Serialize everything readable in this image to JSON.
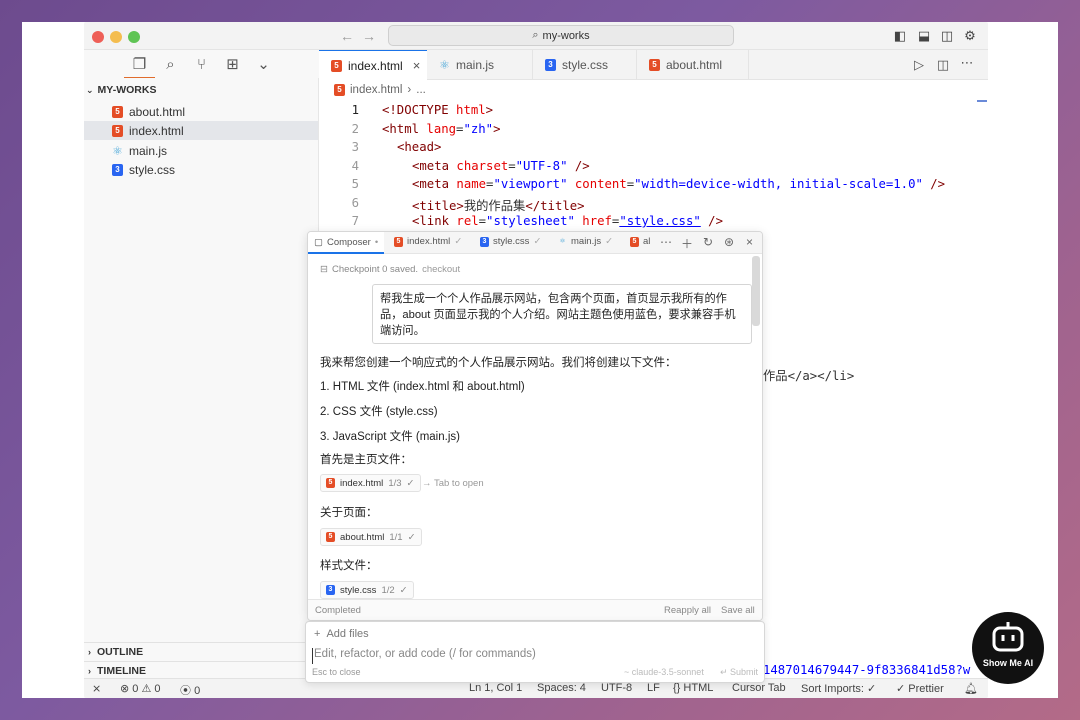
{
  "window": {
    "search_title": "my-works"
  },
  "sidebar": {
    "folder": "MY-WORKS",
    "files": [
      {
        "name": "about.html",
        "type": "html"
      },
      {
        "name": "index.html",
        "type": "html"
      },
      {
        "name": "main.js",
        "type": "js"
      },
      {
        "name": "style.css",
        "type": "css"
      }
    ],
    "outline": "OUTLINE",
    "timeline": "TIMELINE"
  },
  "tabs": [
    "index.html",
    "main.js",
    "style.css",
    "about.html"
  ],
  "breadcrumb": {
    "file": "index.html",
    "more": "..."
  },
  "code": {
    "line_numbers": [
      "1",
      "2",
      "3",
      "4",
      "5",
      "6",
      "7"
    ],
    "line1": [
      "<!DOCTYPE ",
      "html",
      ">"
    ],
    "line2": [
      "<html ",
      "lang",
      "=",
      "\"zh\"",
      ">"
    ],
    "line3": [
      "<head>"
    ],
    "line4": [
      "<meta ",
      "charset",
      "=",
      "\"UTF-8\"",
      " />"
    ],
    "line5": [
      "<meta ",
      "name",
      "=",
      "\"viewport\"",
      " ",
      "content",
      "=",
      "\"width=device-width, initial-scale=1.0\"",
      " />"
    ],
    "line6": [
      "<title>",
      "我的作品集",
      "</title>"
    ],
    "line7": [
      "<link ",
      "rel",
      "=",
      "\"stylesheet\"",
      " ",
      "href",
      "=",
      "\"style.css\"",
      " />"
    ],
    "trail_mid": "作品</a></li>",
    "trail_bottom": "1487014679447-9f8336841d58?w"
  },
  "composer": {
    "tabs": [
      "Composer",
      "index.html",
      "style.css",
      "main.js",
      "al"
    ],
    "checkpoint": "Checkpoint 0 saved.",
    "checkout": "checkout",
    "user_message": "帮我生成一个个人作品展示网站，包含两个页面，首页显示我所有的作品，about 页面显示我的个人介绍。网站主题色使用蓝色，要求兼容手机端访问。",
    "reply_intro": "我来帮您创建一个响应式的个人作品展示网站。我们将创建以下文件：",
    "reply_items": [
      "1. HTML 文件 (index.html 和 about.html)",
      "2. CSS 文件 (style.css)",
      "3. JavaScript 文件 (main.js)"
    ],
    "home_label": "首先是主页文件：",
    "chip1": {
      "name": "index.html",
      "count": "1/3"
    },
    "tab_to_open": "→ Tab to open",
    "about_label": "关于页面：",
    "chip2": {
      "name": "about.html",
      "count": "1/1"
    },
    "style_label": "样式文件：",
    "chip3": {
      "name": "style.css",
      "count": "1/2"
    },
    "status": "Completed",
    "reapply": "Reapply all",
    "save_all": "Save all",
    "add_files": "Add files",
    "placeholder": "Edit, refactor, or add code (/ for commands)",
    "esc": "Esc to close",
    "model": "claude-3.5-sonnet",
    "submit": "Submit"
  },
  "status": {
    "errors": "0",
    "warnings": "0",
    "ports": "0",
    "position": "Ln 1, Col 1",
    "spaces": "Spaces: 4",
    "encoding": "UTF-8",
    "eol": "LF",
    "lang": "HTML",
    "cursor_tab": "Cursor Tab",
    "sort_imports": "Sort Imports: ✓",
    "prettier": "Prettier"
  },
  "badge": {
    "label": "Show Me AI"
  },
  "colors": {
    "accent": "#1a73e8",
    "html_icon": "#e44d26",
    "css_icon": "#2965f1"
  }
}
